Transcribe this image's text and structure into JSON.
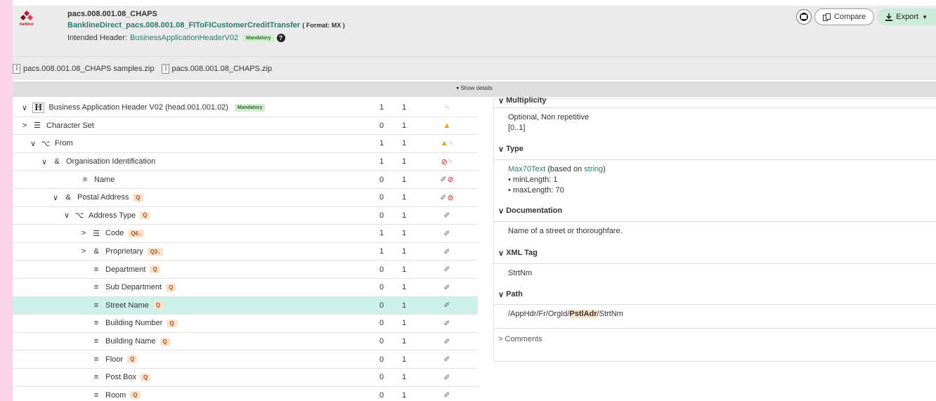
{
  "header": {
    "logo_text": "NatWest",
    "line1": "pacs.008.001.08_CHAPS",
    "line2": "BanklineDirect_pacs.008.001.08_FIToFICustomerCreditTransfer",
    "format": "( Format: MX )",
    "intended_label": "Intended Header:",
    "intended_link": "BusinessApplicationHeaderV02",
    "mandatory": "Mandatory",
    "help": "?",
    "compare_label": "Compare",
    "export_label": "Export"
  },
  "attachments": [
    "pacs.008.001.08_CHAPS samples.zip",
    "pacs.008.001.08_CHAPS.zip"
  ],
  "show_details": "▾ Show details",
  "tree": [
    {
      "label": "Business Application Header V02 (head.001.001.02)",
      "badge": "Mandatory",
      "min": "1",
      "max": "1",
      "chev": "v",
      "icon": "H"
    },
    {
      "label": "Character Set",
      "min": "0",
      "max": "1",
      "chev": ">",
      "icon": "list"
    },
    {
      "label": "From",
      "min": "1",
      "max": "1",
      "chev": "v",
      "icon": "choice"
    },
    {
      "label": "Organisation Identification",
      "min": "1",
      "max": "1",
      "chev": "v",
      "icon": "amp"
    },
    {
      "label": "Name",
      "min": "0",
      "max": "1",
      "chev": "",
      "icon": "text"
    },
    {
      "label": "Postal Address",
      "search": "Q",
      "min": "0",
      "max": "1",
      "chev": "v",
      "icon": "amp"
    },
    {
      "label": "Address Type",
      "search": "Q",
      "min": "0",
      "max": "1",
      "chev": "v",
      "icon": "choice"
    },
    {
      "label": "Code",
      "search": "Q6↓",
      "min": "1",
      "max": "1",
      "chev": ">",
      "icon": "list"
    },
    {
      "label": "Proprietary",
      "search": "Q3↓",
      "min": "1",
      "max": "1",
      "chev": ">",
      "icon": "amp"
    },
    {
      "label": "Department",
      "search": "Q",
      "min": "0",
      "max": "1",
      "chev": "",
      "icon": "text"
    },
    {
      "label": "Sub Department",
      "search": "Q",
      "min": "0",
      "max": "1",
      "chev": "",
      "icon": "text"
    },
    {
      "label": "Street Name",
      "search": "Q",
      "min": "0",
      "max": "1",
      "chev": "",
      "icon": "text"
    },
    {
      "label": "Building Number",
      "search": "Q",
      "min": "0",
      "max": "1",
      "chev": "",
      "icon": "text"
    },
    {
      "label": "Building Name",
      "search": "Q",
      "min": "0",
      "max": "1",
      "chev": "",
      "icon": "text"
    },
    {
      "label": "Floor",
      "search": "Q",
      "min": "0",
      "max": "1",
      "chev": "",
      "icon": "text"
    },
    {
      "label": "Post Box",
      "search": "Q",
      "min": "0",
      "max": "1",
      "chev": "",
      "icon": "text"
    },
    {
      "label": "Room",
      "search": "Q",
      "min": "0",
      "max": "1",
      "chev": "",
      "icon": "text"
    }
  ],
  "panel": {
    "multiplicity_title": "Multiplicity",
    "multiplicity_text": "Optional, Non repetitive",
    "multiplicity_range": "[0..1]",
    "type_title": "Type",
    "type_link": "Max70Text",
    "type_based": "(based on",
    "type_base_link": "string",
    "type_close": ")",
    "type_min": "minLength: 1",
    "type_max": "maxLength: 70",
    "doc_title": "Documentation",
    "doc_text": "Name of a street or thoroughfare.",
    "xml_title": "XML Tag",
    "xml_text": "StrtNm",
    "path_title": "Path",
    "path_pre": "/AppHdr/Fr/OrgId/",
    "path_hl": "PstlAdr",
    "path_post": "/StrtNm",
    "comments_title": "Comments"
  }
}
